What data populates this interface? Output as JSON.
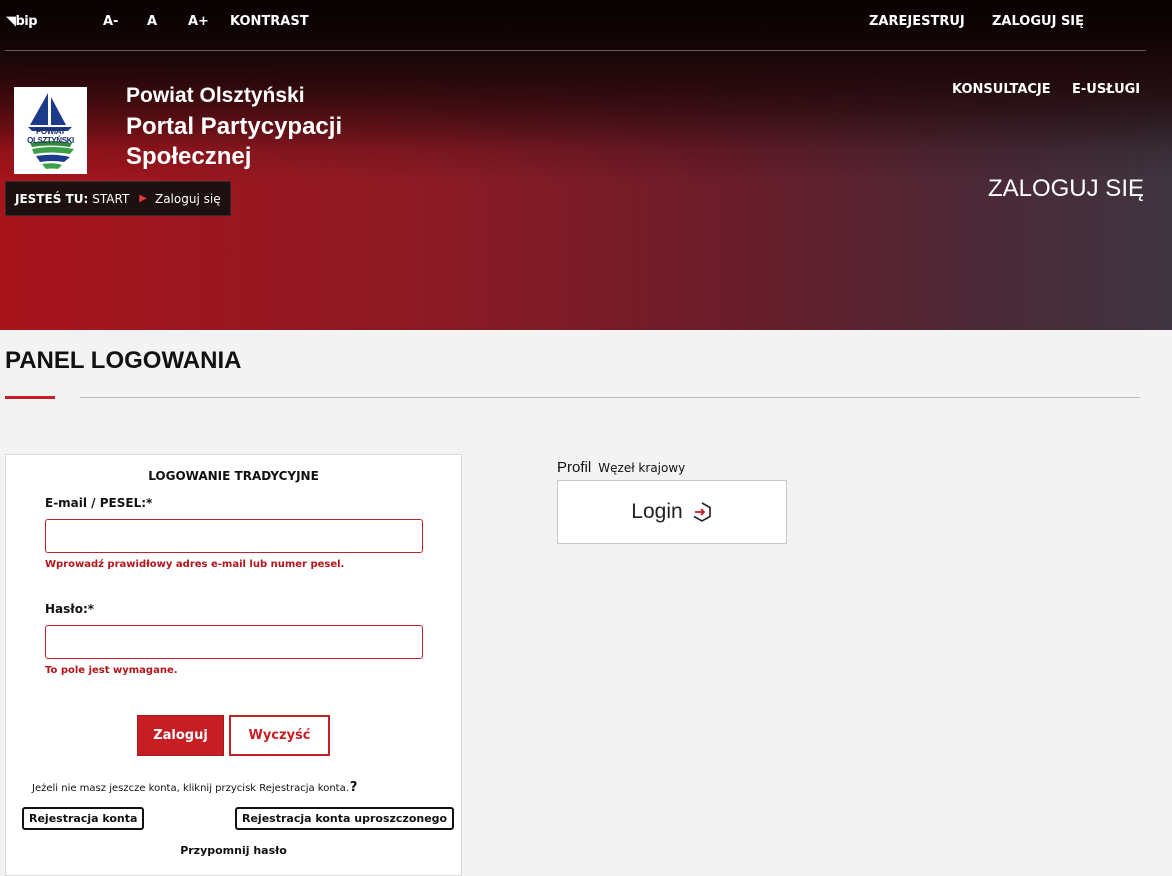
{
  "topbar": {
    "bip": "bip",
    "font_minus": "A-",
    "font_normal": "A",
    "font_plus": "A+",
    "contrast": "KONTRAST",
    "register": "ZAREJESTRUJ",
    "login": "ZALOGUJ SIĘ"
  },
  "header": {
    "logo_text": "POWIAT OLSZTYŃSKI",
    "org": "Powiat Olsztyński",
    "portal_line1": "Portal Partycypacji",
    "portal_line2": "Społecznej",
    "nav": [
      "KONSULTACJE",
      "E-USŁUGI"
    ],
    "page_title": "ZALOGUJ SIĘ"
  },
  "breadcrumb": {
    "label": "JESTEŚ TU:",
    "items": [
      "START",
      "Zaloguj się"
    ]
  },
  "main": {
    "title": "PANEL LOGOWANIA"
  },
  "login_form": {
    "heading": "LOGOWANIE TRADYCYJNE",
    "email_label": "E-mail / PESEL:*",
    "email_value": "",
    "email_error": "Wprowadź prawidłowy adres e-mail lub numer pesel.",
    "password_label": "Hasło:*",
    "password_value": "",
    "password_error": "To pole jest wymagane.",
    "submit": "Zaloguj",
    "clear": "Wyczyść",
    "info": "Jeżeli nie masz jeszcze konta, kliknij przycisk Rejestracja konta.",
    "info_q": "?",
    "register": "Rejestracja konta",
    "register_simple": "Rejestracja konta uproszczonego",
    "remind": "Przypomnij hasło"
  },
  "profil": {
    "title": "Profil",
    "subtitle": "Węzeł krajowy",
    "button": "Login"
  },
  "colors": {
    "accent": "#c51f25",
    "error": "#b3151b"
  }
}
